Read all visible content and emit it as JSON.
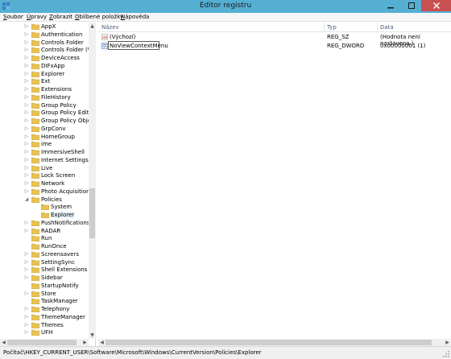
{
  "window": {
    "title": "Editor registru"
  },
  "menu": [
    {
      "first": "S",
      "rest": "oubor"
    },
    {
      "first": "Ú",
      "rest": "pravy"
    },
    {
      "first": "Z",
      "rest": "obrazit"
    },
    {
      "first": "O",
      "rest": "blíbené položky"
    },
    {
      "first": "N",
      "rest": "ápověda"
    }
  ],
  "tree": [
    {
      "label": "AppX",
      "indent": 0,
      "expander": "collapsed",
      "selected": false
    },
    {
      "label": "Authentication",
      "indent": 0,
      "expander": "collapsed",
      "selected": false
    },
    {
      "label": "Controls Folder",
      "indent": 0,
      "expander": "collapsed",
      "selected": false
    },
    {
      "label": "Controls Folder (Wow",
      "indent": 0,
      "expander": "collapsed",
      "selected": false
    },
    {
      "label": "DeviceAccess",
      "indent": 0,
      "expander": "collapsed",
      "selected": false
    },
    {
      "label": "DIFxApp",
      "indent": 0,
      "expander": "collapsed",
      "selected": false
    },
    {
      "label": "Explorer",
      "indent": 0,
      "expander": "collapsed",
      "selected": false
    },
    {
      "label": "Ext",
      "indent": 0,
      "expander": "collapsed",
      "selected": false
    },
    {
      "label": "Extensions",
      "indent": 0,
      "expander": "collapsed",
      "selected": false
    },
    {
      "label": "FileHistory",
      "indent": 0,
      "expander": "collapsed",
      "selected": false
    },
    {
      "label": "Group Policy",
      "indent": 0,
      "expander": "collapsed",
      "selected": false
    },
    {
      "label": "Group Policy Editor",
      "indent": 0,
      "expander": "collapsed",
      "selected": false
    },
    {
      "label": "Group Policy Objects",
      "indent": 0,
      "expander": "collapsed",
      "selected": false
    },
    {
      "label": "GrpConv",
      "indent": 0,
      "expander": "collapsed",
      "selected": false
    },
    {
      "label": "HomeGroup",
      "indent": 0,
      "expander": "collapsed",
      "selected": false
    },
    {
      "label": "ime",
      "indent": 0,
      "expander": "collapsed",
      "selected": false
    },
    {
      "label": "ImmersiveShell",
      "indent": 0,
      "expander": "collapsed",
      "selected": false
    },
    {
      "label": "Internet Settings",
      "indent": 0,
      "expander": "collapsed",
      "selected": false
    },
    {
      "label": "Live",
      "indent": 0,
      "expander": "collapsed",
      "selected": false
    },
    {
      "label": "Lock Screen",
      "indent": 0,
      "expander": "collapsed",
      "selected": false
    },
    {
      "label": "Network",
      "indent": 0,
      "expander": "collapsed",
      "selected": false
    },
    {
      "label": "Photo Acquisition",
      "indent": 0,
      "expander": "collapsed",
      "selected": false
    },
    {
      "label": "Policies",
      "indent": 0,
      "expander": "expanded",
      "selected": false
    },
    {
      "label": "System",
      "indent": 1,
      "expander": "none",
      "selected": false
    },
    {
      "label": "Explorer",
      "indent": 1,
      "expander": "none",
      "selected": true
    },
    {
      "label": "PushNotifications",
      "indent": 0,
      "expander": "collapsed",
      "selected": false
    },
    {
      "label": "RADAR",
      "indent": 0,
      "expander": "collapsed",
      "selected": false
    },
    {
      "label": "Run",
      "indent": 0,
      "expander": "none",
      "selected": false
    },
    {
      "label": "RunOnce",
      "indent": 0,
      "expander": "none",
      "selected": false
    },
    {
      "label": "Screensavers",
      "indent": 0,
      "expander": "collapsed",
      "selected": false
    },
    {
      "label": "SettingSync",
      "indent": 0,
      "expander": "collapsed",
      "selected": false
    },
    {
      "label": "Shell Extensions",
      "indent": 0,
      "expander": "collapsed",
      "selected": false
    },
    {
      "label": "Sidebar",
      "indent": 0,
      "expander": "collapsed",
      "selected": false
    },
    {
      "label": "StartupNotify",
      "indent": 0,
      "expander": "none",
      "selected": false
    },
    {
      "label": "Store",
      "indent": 0,
      "expander": "collapsed",
      "selected": false
    },
    {
      "label": "TaskManager",
      "indent": 0,
      "expander": "none",
      "selected": false
    },
    {
      "label": "Telephony",
      "indent": 0,
      "expander": "collapsed",
      "selected": false
    },
    {
      "label": "ThemeManager",
      "indent": 0,
      "expander": "collapsed",
      "selected": false
    },
    {
      "label": "Themes",
      "indent": 0,
      "expander": "collapsed",
      "selected": false
    },
    {
      "label": "UFH",
      "indent": 0,
      "expander": "collapsed",
      "selected": false
    }
  ],
  "list": {
    "columns": {
      "name": "Název",
      "type": "Typ",
      "data": "Data"
    },
    "rows": [
      {
        "name": "(Výchozí)",
        "type": "REG_SZ",
        "data": "(Hodnota není nastavena.)",
        "icon": "string-value-icon",
        "editing": false
      },
      {
        "name": "NoViewContextMenu",
        "type": "REG_DWORD",
        "data": "0x00000001 (1)",
        "icon": "dword-value-icon",
        "editing": true
      }
    ]
  },
  "status": {
    "path": "Počítač\\HKEY_CURRENT_USER\\Software\\Microsoft\\Windows\\CurrentVersion\\Policies\\Explorer"
  },
  "colors": {
    "titlebar": "#55afd3",
    "close": "#c75050",
    "folder": "#e8c254",
    "selection": "#e5f3fb"
  }
}
